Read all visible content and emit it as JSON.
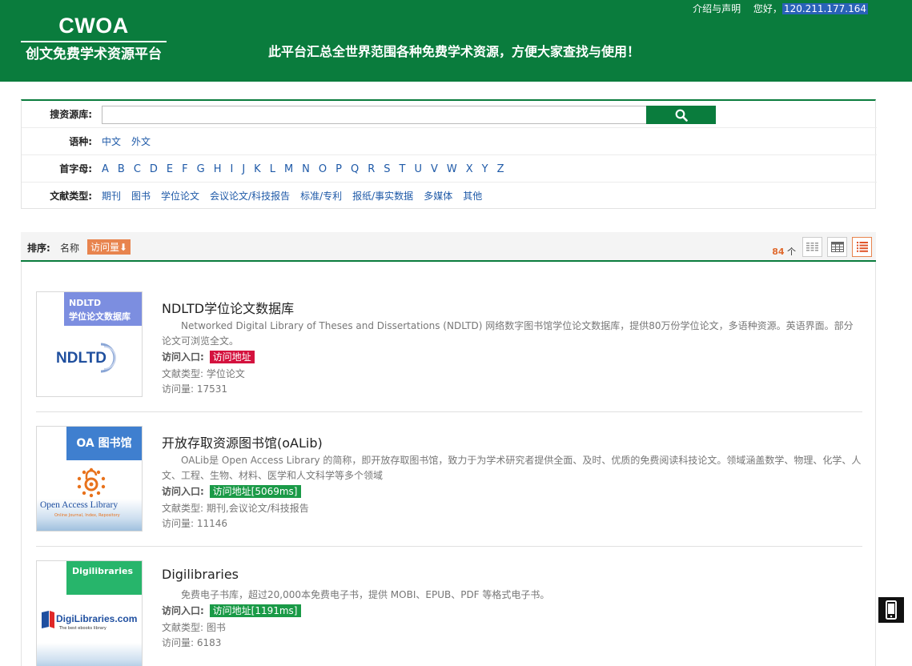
{
  "header": {
    "logo_title": "CWOA",
    "logo_subtitle": "创文免费学术资源平台",
    "slogan": "此平台汇总全世界范围各种免费学术资源，方便大家查找与使用！",
    "links": {
      "about": "介绍与声明",
      "greeting": "您好，",
      "ip": "120.211.177.164"
    }
  },
  "search": {
    "label": "搜资源库:",
    "value": "",
    "placeholder": "",
    "button_icon": "search-icon",
    "language_label": "语种:",
    "languages": [
      "中文",
      "外文"
    ],
    "letter_label": "首字母:",
    "letters": [
      "A",
      "B",
      "C",
      "D",
      "E",
      "F",
      "G",
      "H",
      "I",
      "J",
      "K",
      "L",
      "M",
      "N",
      "O",
      "P",
      "Q",
      "R",
      "S",
      "T",
      "U",
      "V",
      "W",
      "X",
      "Y",
      "Z"
    ],
    "type_label": "文献类型:",
    "types": [
      "期刊",
      "图书",
      "学位论文",
      "会议论文/科技报告",
      "标准/专利",
      "报纸/事实数据",
      "多媒体",
      "其他"
    ]
  },
  "sort": {
    "label": "排序:",
    "name": "名称",
    "visits": "访问量⬇",
    "count": "84",
    "count_unit": "个",
    "view_icons": [
      "grid-view-icon",
      "table-view-icon",
      "list-view-icon"
    ]
  },
  "entries": [
    {
      "title": "NDLTD学位论文数据库",
      "tag_line1": "NDLTD",
      "tag_line2": "学位论文数据库",
      "logo_text": "NDLTD",
      "desc": "Networked Digital Library of Theses and Dissertations (NDLTD) 网络数字图书馆学位论文数据库，提供80万份学位论文，多语种资源。英语界面。部分论文可浏览全文。",
      "access_label": "访问入口:",
      "access_badge": "访问地址",
      "access_color": "#d4123e",
      "type_label": "文献类型:",
      "type_value": "学位论文",
      "visits_label": "访问量:",
      "visits_value": "17531"
    },
    {
      "title": "开放存取资源图书馆(oALib)",
      "tag_line1": "OA 图书馆",
      "logo_text": "Open Access Library",
      "logo_caption": "Online Journal, Index, Repository",
      "desc": "OALib是 Open Access Library 的简称，即开放存取图书馆，致力于为学术研究者提供全面、及时、优质的免费阅读科技论文。领域涵盖数学、物理、化学、人文、工程、生物、材料、医学和人文科学等多个领域",
      "access_label": "访问入口:",
      "access_badge": "访问地址[5069ms]",
      "access_color": "#1a9a47",
      "type_label": "文献类型:",
      "type_value": "期刊,会议论文/科技报告",
      "visits_label": "访问量:",
      "visits_value": "11146"
    },
    {
      "title": "Digilibraries",
      "tag_line1": "Digilibraries",
      "logo_text": "DigiLibraries.com",
      "logo_caption": "The best ebooks library",
      "desc": "免费电子书库，超过20,000本免费电子书，提供 MOBI、EPUB、PDF 等格式电子书。",
      "access_label": "访问入口:",
      "access_badge": "访问地址[1191ms]",
      "access_color": "#1a9a47",
      "type_label": "文献类型:",
      "type_value": "图书",
      "visits_label": "访问量:",
      "visits_value": "6183"
    }
  ],
  "mobile_icon": "mobile-phone-icon"
}
